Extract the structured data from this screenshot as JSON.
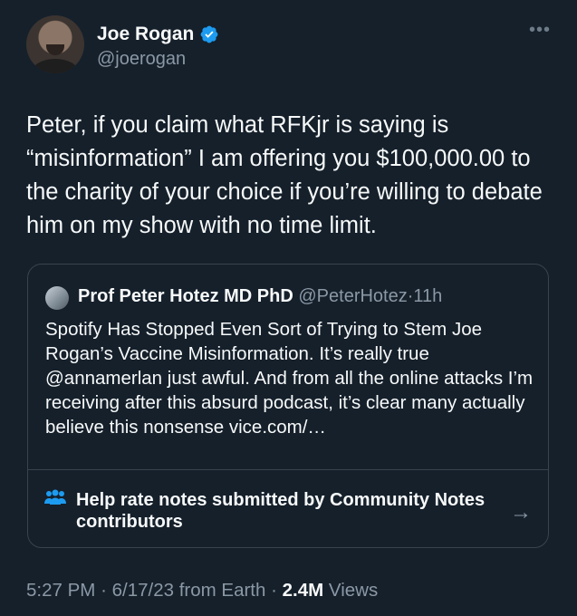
{
  "author": {
    "name": "Joe Rogan",
    "handle": "@joerogan",
    "verified": true
  },
  "tweet": {
    "text": "Peter, if you claim what RFKjr is saying is “misinformation” I am offering you $100,000.00 to the charity of your choice if you’re willing to debate him on my show with no time limit."
  },
  "quote": {
    "name": "Prof Peter Hotez MD PhD",
    "handle": "@PeterHotez",
    "separator": "·",
    "time": "11h",
    "text": "Spotify Has Stopped Even Sort of Trying to Stem Joe Rogan’s Vaccine Misinformation. It’s really true @annamerlan just awful. And from all the online attacks I’m receiving after this absurd podcast, it’s clear many actually believe this nonsense vice.com/…"
  },
  "community_notes": {
    "label": "Help rate notes submitted by Community Notes contributors",
    "arrow": "→"
  },
  "footer": {
    "time": "5:27 PM",
    "sep1": "·",
    "date": "6/17/23",
    "source": "from Earth",
    "sep2": "·",
    "views_count": "2.4M",
    "views_label": "Views"
  },
  "colors": {
    "background": "#15202b",
    "verified": "#1d9bf0",
    "secondary_text": "#8b98a5",
    "border": "#38444d"
  },
  "icons": {
    "verified": "verified-badge-icon",
    "more": "more-options-icon",
    "notes": "community-notes-icon",
    "arrow": "arrow-right-icon"
  }
}
